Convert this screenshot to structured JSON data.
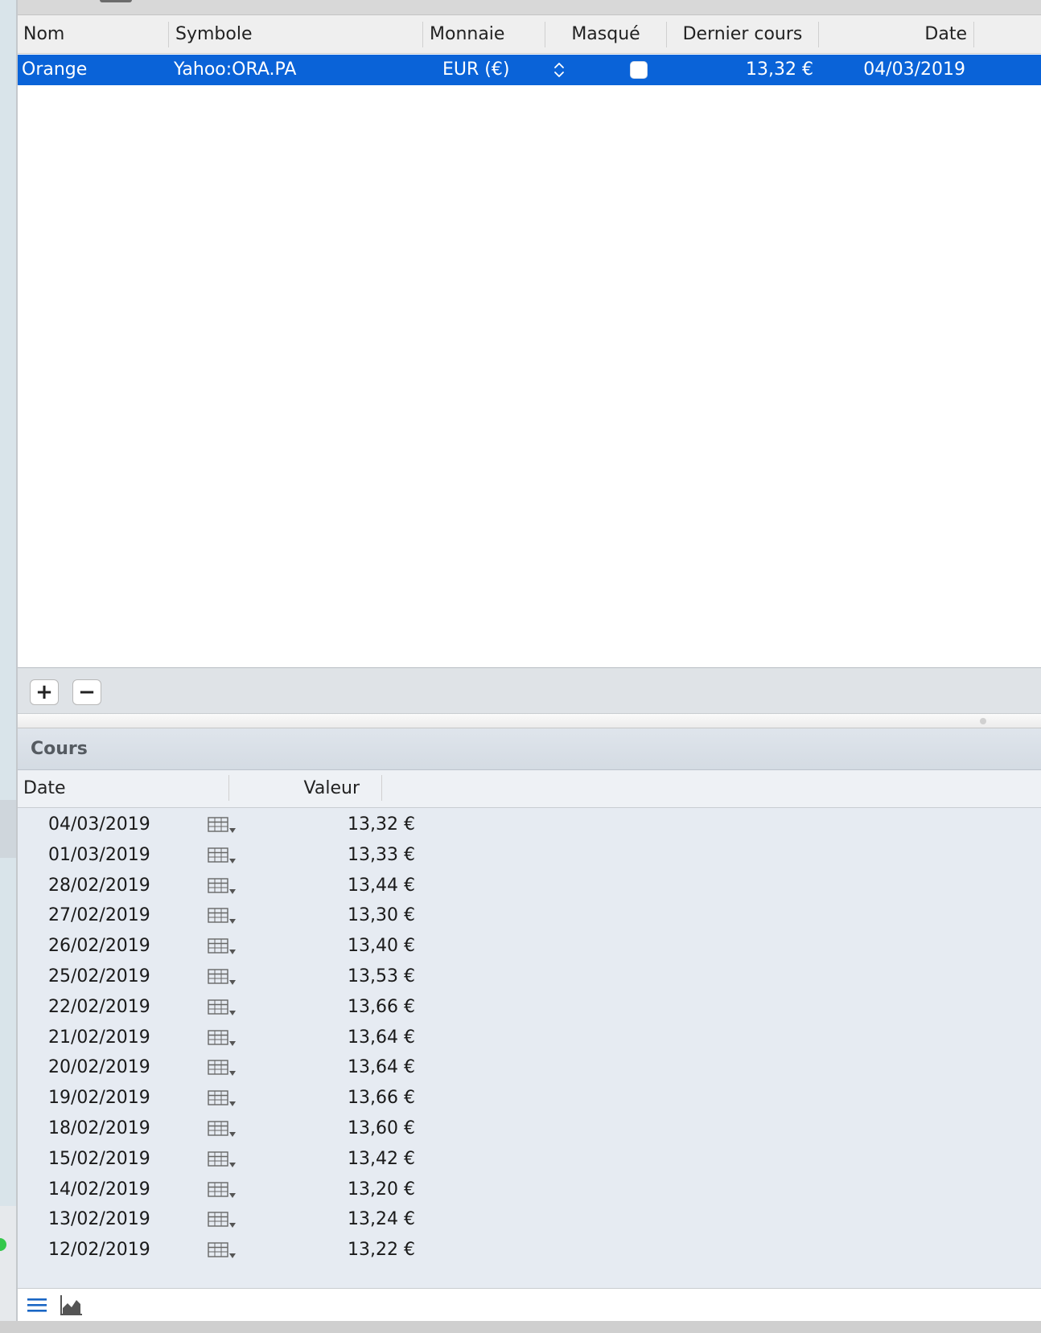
{
  "securities": {
    "columns": [
      "Nom",
      "Symbole",
      "Monnaie",
      "Masqué",
      "Dernier cours",
      "Date"
    ],
    "rows": [
      {
        "nom": "Orange",
        "symbole": "Yahoo:ORA.PA",
        "monnaie": "EUR (€)",
        "masque": false,
        "dernier_cours": "13,32 €",
        "date": "04/03/2019",
        "selected": true
      }
    ]
  },
  "buttons": {
    "add": "+",
    "remove": "−"
  },
  "cours": {
    "title": "Cours",
    "columns": [
      "Date",
      "Valeur"
    ],
    "rows": [
      {
        "date": "04/03/2019",
        "valeur": "13,32 €"
      },
      {
        "date": "01/03/2019",
        "valeur": "13,33 €"
      },
      {
        "date": "28/02/2019",
        "valeur": "13,44 €"
      },
      {
        "date": "27/02/2019",
        "valeur": "13,30 €"
      },
      {
        "date": "26/02/2019",
        "valeur": "13,40 €"
      },
      {
        "date": "25/02/2019",
        "valeur": "13,53 €"
      },
      {
        "date": "22/02/2019",
        "valeur": "13,66 €"
      },
      {
        "date": "21/02/2019",
        "valeur": "13,64 €"
      },
      {
        "date": "20/02/2019",
        "valeur": "13,64 €"
      },
      {
        "date": "19/02/2019",
        "valeur": "13,66 €"
      },
      {
        "date": "18/02/2019",
        "valeur": "13,60 €"
      },
      {
        "date": "15/02/2019",
        "valeur": "13,42 €"
      },
      {
        "date": "14/02/2019",
        "valeur": "13,20 €"
      },
      {
        "date": "13/02/2019",
        "valeur": "13,24 €"
      },
      {
        "date": "12/02/2019",
        "valeur": "13,22 €"
      }
    ]
  },
  "toolbar": {
    "icons": [
      "list-view-icon",
      "chart-view-icon"
    ]
  },
  "colors": {
    "selection": "#0a63d8",
    "accent": "#1a66c4",
    "prices_bg": "#e6ebf2"
  }
}
